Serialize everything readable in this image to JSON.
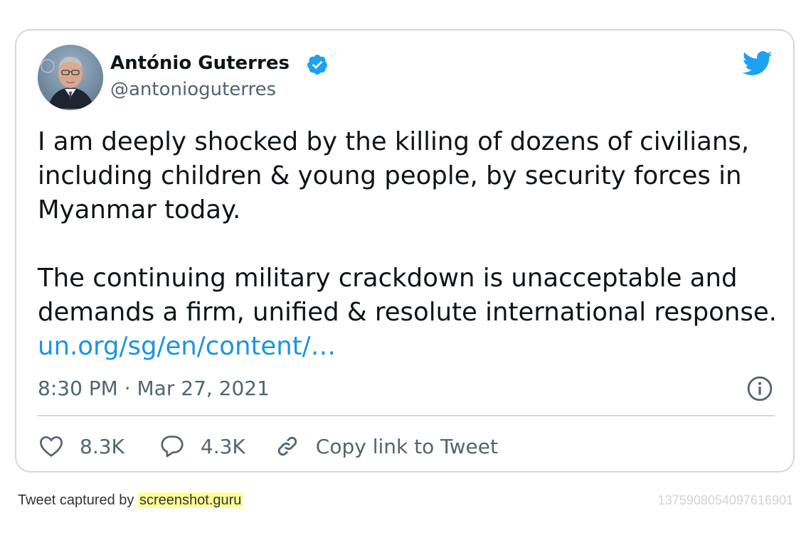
{
  "tweet": {
    "author": {
      "name": "António Guterres",
      "handle": "@antonioguterres",
      "verified": true
    },
    "paragraphs": [
      "I am deeply shocked by the killing of dozens of civilians, including children & young people, by security forces in Myanmar today.",
      "The continuing military crackdown is unacceptable and demands a firm, unified & resolute international response."
    ],
    "link_text": "un.org/sg/en/content/…",
    "timestamp": "8:30 PM · Mar 27, 2021",
    "actions": {
      "likes": "8.3K",
      "replies": "4.3K",
      "copy_link_label": "Copy link to Tweet"
    }
  },
  "footer": {
    "caption_prefix": "Tweet captured by",
    "caption_link": "screenshot.guru",
    "tweet_id": "1375908054097616901"
  },
  "icons": {
    "brand": "twitter-bird-icon",
    "verified": "verified-badge-icon",
    "info": "info-icon",
    "like": "heart-icon",
    "reply": "comment-icon",
    "copy": "link-icon"
  },
  "colors": {
    "text": "#0f1419",
    "muted": "#536471",
    "link": "#1b95e0",
    "brand": "#1da1f2",
    "border": "#cfd9de",
    "footer_highlight": "#ffff99"
  }
}
